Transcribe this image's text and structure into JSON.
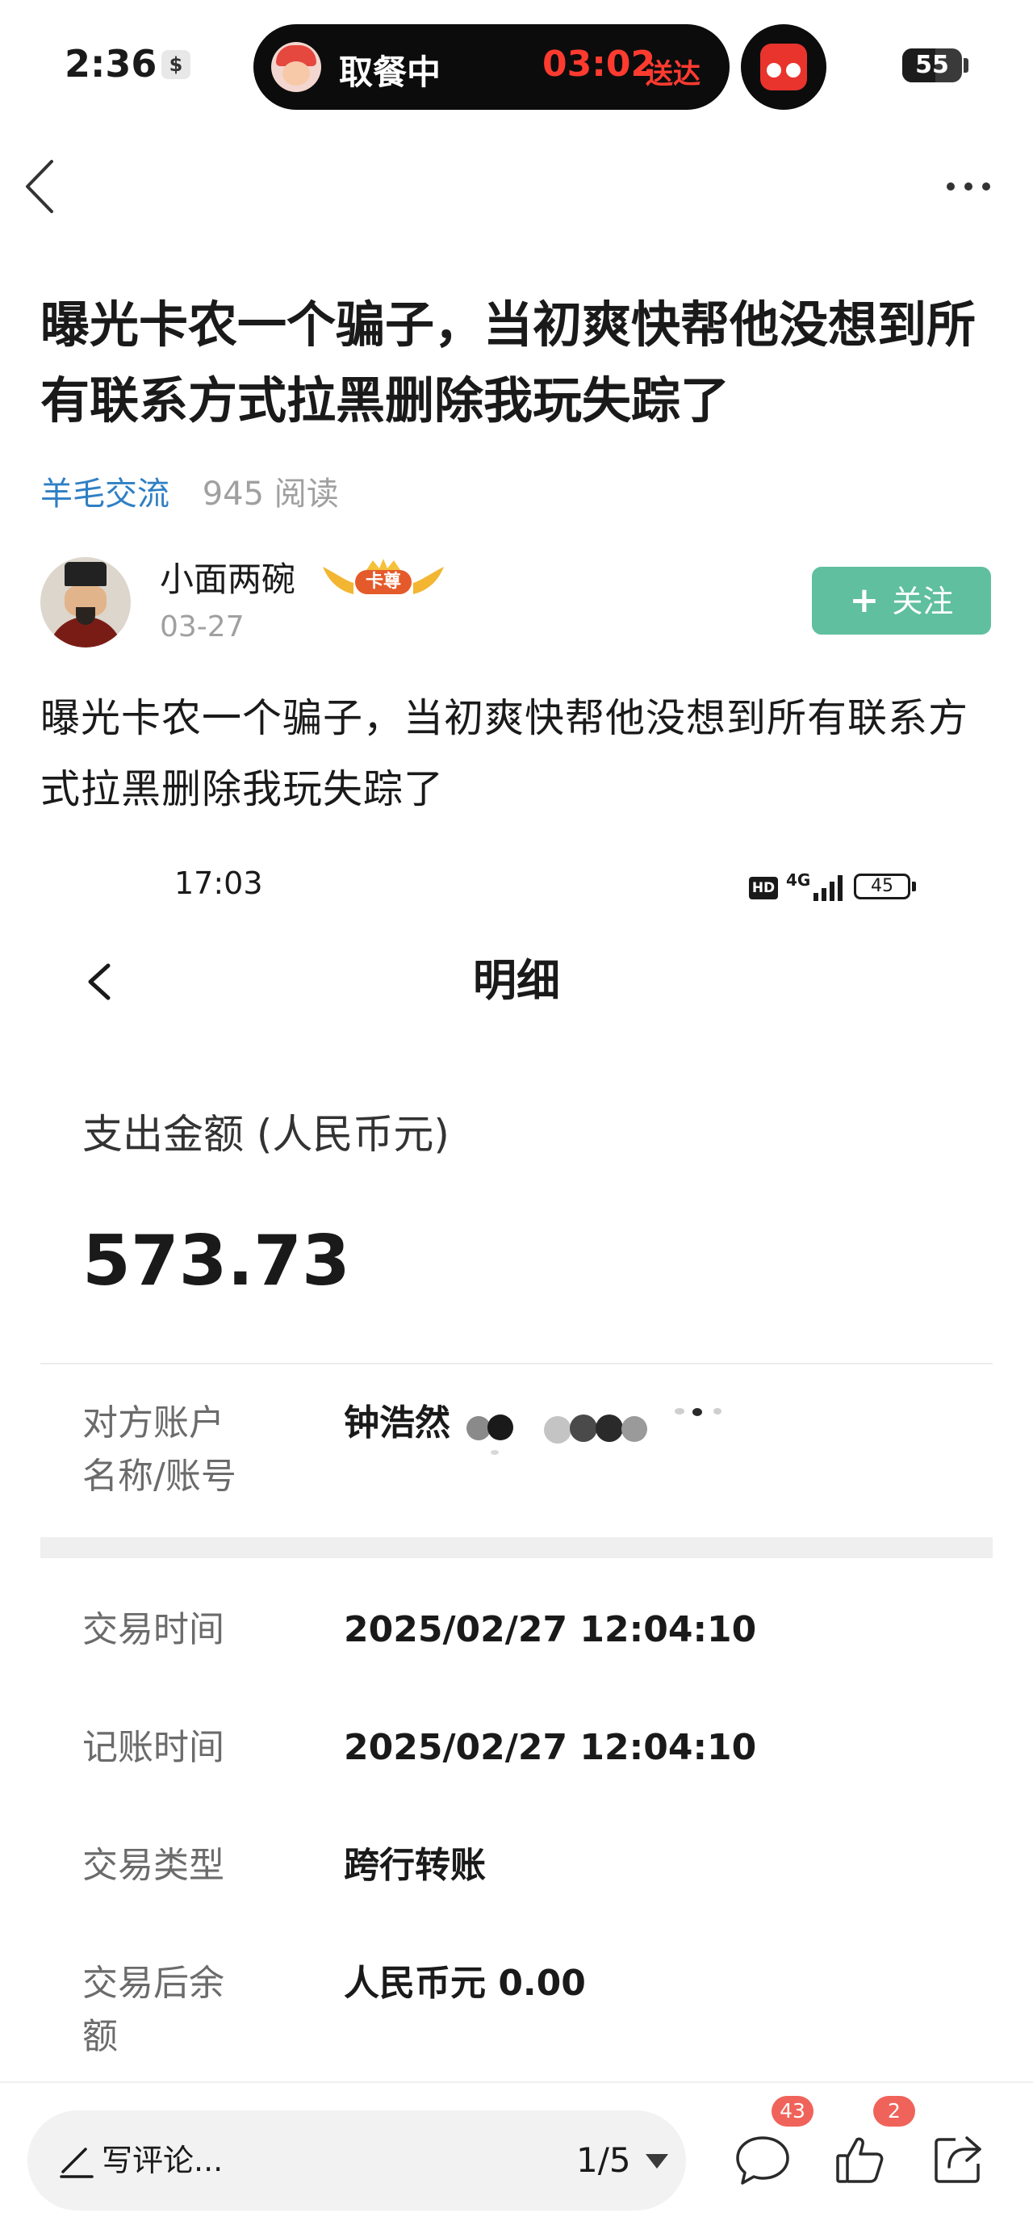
{
  "status_bar": {
    "time": "2:36",
    "app_icon_glyph": "$",
    "island_label": "取餐中",
    "island_countdown": "03:02",
    "island_suffix": "送达",
    "battery_level": "55",
    "battery_fraction": 0.55
  },
  "post": {
    "title": "曝光卡农一个骗子，当初爽快帮他没想到所有联系方式拉黑删除我玩失踪了",
    "category": "羊毛交流",
    "reads": "945 阅读",
    "author": {
      "name": "小面两碗",
      "badge": "卡尊",
      "date": "03-27"
    },
    "follow_label": "关注",
    "body": "曝光卡农一个骗子，当初爽快帮他没想到所有联系方式拉黑删除我玩失踪了"
  },
  "screenshot": {
    "time": "17:03",
    "hd": "HD",
    "network": "4G",
    "battery": "45",
    "title": "明细",
    "amount_label": "支出金额 (人民币元)",
    "amount": "573.73",
    "rows": [
      {
        "label_line1": "对方账户",
        "label_line2": "名称/账号",
        "value": "钟浩然"
      },
      {
        "label": "交易时间",
        "value": "2025/02/27 12:04:10"
      },
      {
        "label": "记账时间",
        "value": "2025/02/27 12:04:10"
      },
      {
        "label": "交易类型",
        "value": "跨行转账"
      },
      {
        "label_line1": "交易后余",
        "label_line2": "额",
        "value": "人民币元 0.00"
      }
    ]
  },
  "bottom_bar": {
    "comment_placeholder": "写评论...",
    "pager": "1/5",
    "comment_count": "43",
    "like_count": "2"
  },
  "colors": {
    "follow_green": "#5fbf9f",
    "category_blue": "#2f7fc4",
    "badge_red": "#f0635a",
    "countdown_red": "#ff3b30"
  }
}
